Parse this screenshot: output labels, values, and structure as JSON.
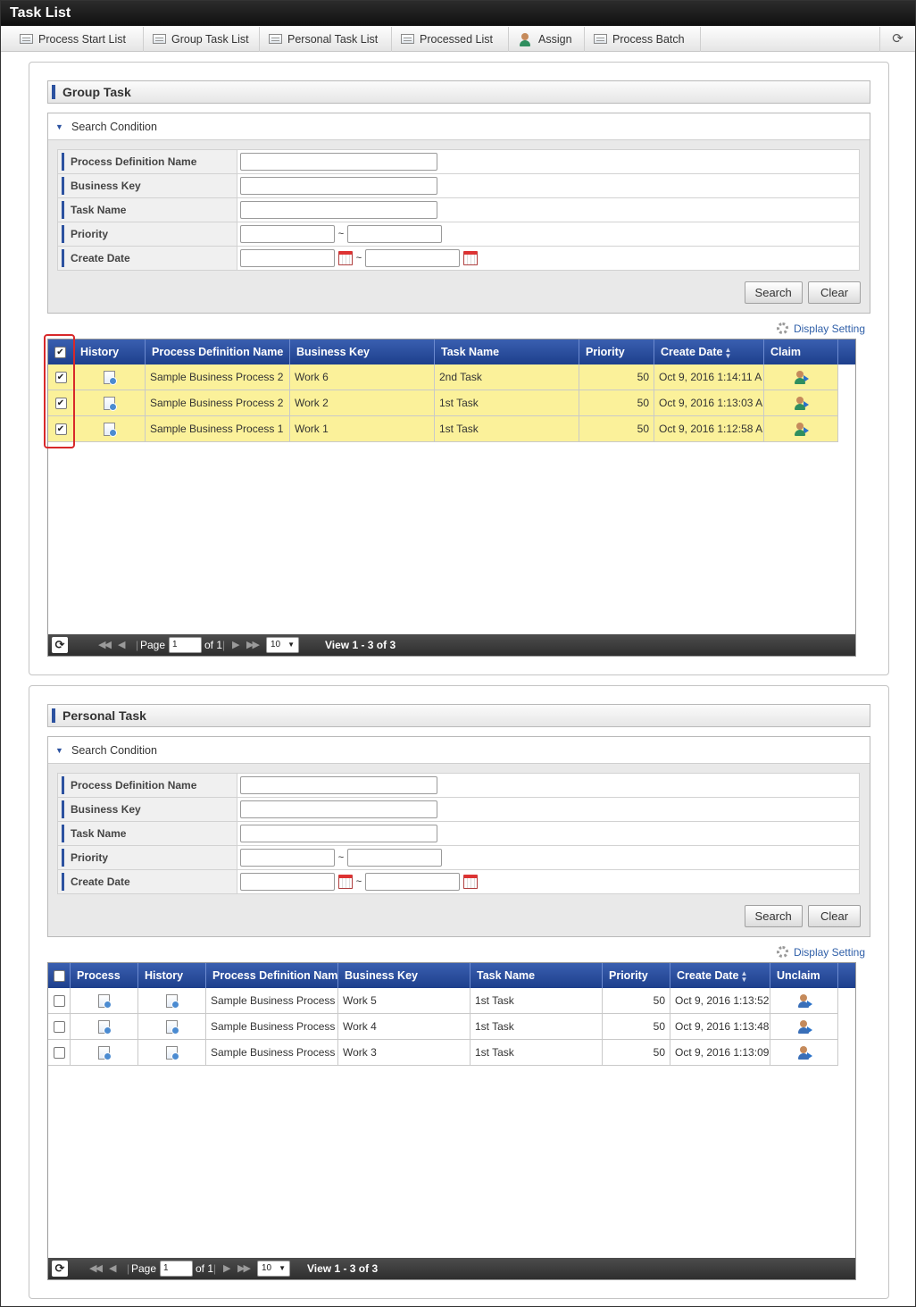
{
  "window": {
    "title": "Task List"
  },
  "toolbar": {
    "items": [
      {
        "label": "Process Start List",
        "icon": "list-icon"
      },
      {
        "label": "Group Task List",
        "icon": "list-icon"
      },
      {
        "label": "Personal Task List",
        "icon": "list-icon"
      },
      {
        "label": "Processed List",
        "icon": "list-icon"
      },
      {
        "label": "Assign",
        "icon": "assign-user-icon"
      },
      {
        "label": "Process Batch",
        "icon": "batch-icon"
      }
    ],
    "refresh_icon": "refresh-icon"
  },
  "group_task": {
    "title": "Group Task",
    "search": {
      "header": "Search Condition",
      "fields": {
        "process_definition_name": "Process Definition Name",
        "business_key": "Business Key",
        "task_name": "Task Name",
        "priority": "Priority",
        "create_date": "Create Date"
      },
      "tilde": "~",
      "search_button": "Search",
      "clear_button": "Clear"
    },
    "display_setting": "Display Setting",
    "columns": {
      "history": "History",
      "process_definition_name": "Process Definition Name",
      "business_key": "Business Key",
      "task_name": "Task Name",
      "priority": "Priority",
      "create_date": "Create Date",
      "claim": "Claim"
    },
    "rows": [
      {
        "checked": true,
        "process_definition_name": "Sample Business Process 2",
        "business_key": "Work 6",
        "task_name": "2nd Task",
        "priority": "50",
        "create_date": "Oct 9, 2016 1:14:11 A"
      },
      {
        "checked": true,
        "process_definition_name": "Sample Business Process 2",
        "business_key": "Work 2",
        "task_name": "1st Task",
        "priority": "50",
        "create_date": "Oct 9, 2016 1:13:03 A"
      },
      {
        "checked": true,
        "process_definition_name": "Sample Business Process 1",
        "business_key": "Work 1",
        "task_name": "1st Task",
        "priority": "50",
        "create_date": "Oct 9, 2016 1:12:58 A"
      }
    ],
    "pager": {
      "page_label": "Page",
      "page": "1",
      "of_label": "of 1",
      "page_size": "10",
      "view_info": "View 1 - 3 of 3"
    },
    "highlight_color": "#fbf19a"
  },
  "personal_task": {
    "title": "Personal Task",
    "search": {
      "header": "Search Condition",
      "fields": {
        "process_definition_name": "Process Definition Name",
        "business_key": "Business Key",
        "task_name": "Task Name",
        "priority": "Priority",
        "create_date": "Create Date"
      },
      "tilde": "~",
      "search_button": "Search",
      "clear_button": "Clear"
    },
    "display_setting": "Display Setting",
    "columns": {
      "process": "Process",
      "history": "History",
      "process_definition_name": "Process Definition Name",
      "business_key": "Business Key",
      "task_name": "Task Name",
      "priority": "Priority",
      "create_date": "Create Date",
      "unclaim": "Unclaim"
    },
    "rows": [
      {
        "checked": false,
        "process_definition_name": "Sample Business Process",
        "business_key": "Work 5",
        "task_name": "1st Task",
        "priority": "50",
        "create_date": "Oct 9, 2016 1:13:52"
      },
      {
        "checked": false,
        "process_definition_name": "Sample Business Process",
        "business_key": "Work 4",
        "task_name": "1st Task",
        "priority": "50",
        "create_date": "Oct 9, 2016 1:13:48"
      },
      {
        "checked": false,
        "process_definition_name": "Sample Business Process",
        "business_key": "Work 3",
        "task_name": "1st Task",
        "priority": "50",
        "create_date": "Oct 9, 2016 1:13:09"
      }
    ],
    "pager": {
      "page_label": "Page",
      "page": "1",
      "of_label": "of 1",
      "page_size": "10",
      "view_info": "View 1 - 3 of 3"
    }
  },
  "colors": {
    "header_blue": "#264a9a",
    "accent_red": "#d8282a",
    "link_blue": "#2f5fa8"
  }
}
